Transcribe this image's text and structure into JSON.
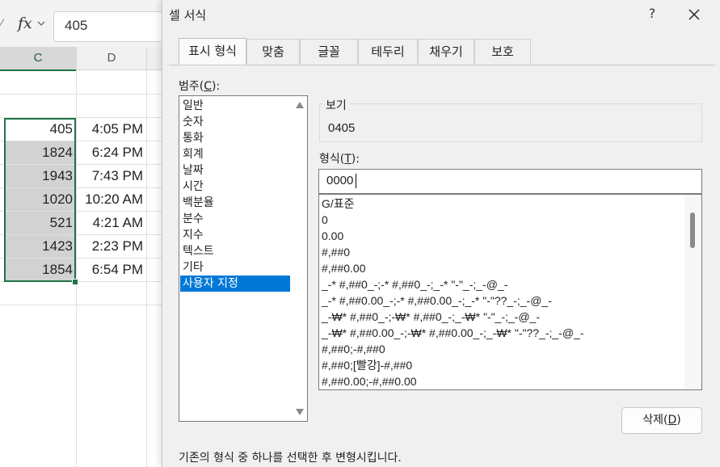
{
  "formula_bar": {
    "fx_label": "fx",
    "value": "405"
  },
  "sheet": {
    "col_headers": [
      "C",
      "D"
    ],
    "col_c": [
      "405",
      "1824",
      "1943",
      "1020",
      "521",
      "1423",
      "1854"
    ],
    "col_d": [
      "4:05 PM",
      "6:24 PM",
      "7:43 PM",
      "10:20 AM",
      "4:21 AM",
      "2:23 PM",
      "6:54 PM"
    ]
  },
  "dialog": {
    "title": "셀 서식",
    "help": "?",
    "tabs": [
      "표시 형식",
      "맞춤",
      "글꼴",
      "테두리",
      "채우기",
      "보호"
    ],
    "category_label_pre": "범주(",
    "category_label_key": "C",
    "category_label_post": "):",
    "categories": [
      "일반",
      "숫자",
      "통화",
      "회계",
      "날짜",
      "시간",
      "백분율",
      "분수",
      "지수",
      "텍스트",
      "기타",
      "사용자 지정"
    ],
    "selected_category": "사용자 지정",
    "sample_label": "보기",
    "sample_value": "0405",
    "type_label_pre": "형식(",
    "type_label_key": "T",
    "type_label_post": "):",
    "type_value": "0000",
    "formats": [
      "G/표준",
      "0",
      "0.00",
      "#,##0",
      "#,##0.00",
      "_-* #,##0_-;-* #,##0_-;_-* \"-\"_-;_-@_-",
      "_-* #,##0.00_-;-* #,##0.00_-;_-* \"-\"??_-;_-@_-",
      "_-₩* #,##0_-;-₩* #,##0_-;_-₩* \"-\"_-;_-@_-",
      "_-₩* #,##0.00_-;-₩* #,##0.00_-;_-₩* \"-\"??_-;_-@_-",
      "#,##0;-#,##0",
      "#,##0;[빨강]-#,##0",
      "#,##0.00;-#,##0.00"
    ],
    "delete_pre": "삭제(",
    "delete_key": "D",
    "delete_post": ")",
    "hint": "기존의 형식 중 하나를 선택한 후 변형시킵니다."
  }
}
